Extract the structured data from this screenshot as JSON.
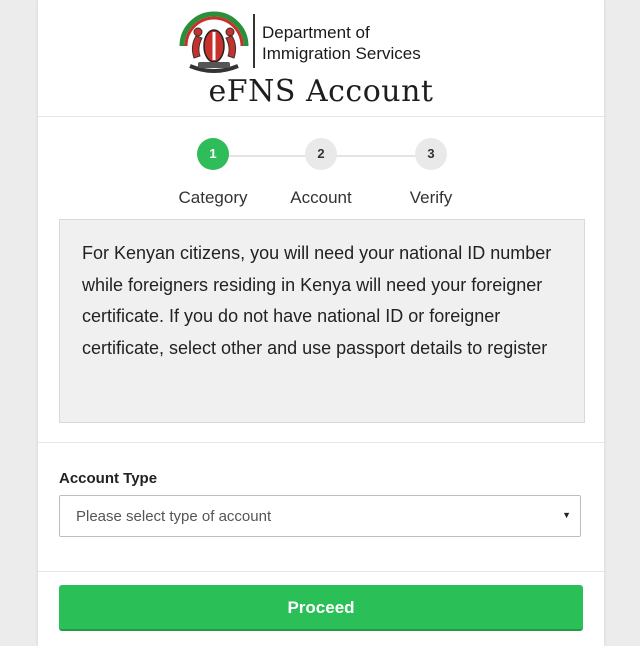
{
  "header": {
    "department_line1": "Department of",
    "department_line2": "Immigration Services",
    "app_title": "eFNS Account"
  },
  "stepper": {
    "steps": [
      {
        "number": "1",
        "label": "Category",
        "active": true
      },
      {
        "number": "2",
        "label": "Account",
        "active": false
      },
      {
        "number": "3",
        "label": "Verify",
        "active": false
      }
    ]
  },
  "info": {
    "text": "For Kenyan citizens, you will need your national ID number while foreigners residing in Kenya will need your foreigner certificate. If you do not have national ID or foreigner certificate, select other and use passport details to register"
  },
  "form": {
    "account_type_label": "Account Type",
    "account_type_placeholder": "Please select type of account",
    "proceed_label": "Proceed"
  },
  "colors": {
    "accent": "#2ebd59",
    "button": "#2bbf58",
    "info_bg": "#f0f0f0"
  },
  "icons": {
    "logo": "kenya-coat-of-arms-icon",
    "select_caret": "caret-down-icon"
  }
}
